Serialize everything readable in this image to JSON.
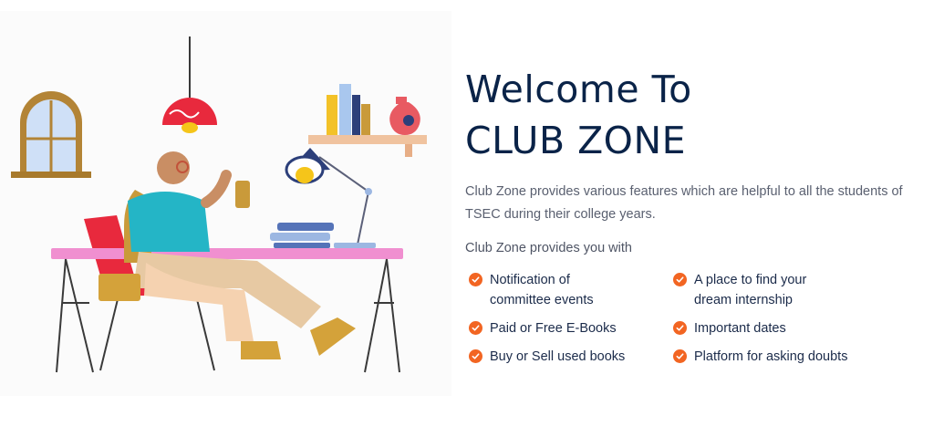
{
  "hero": {
    "title_line1": "Welcome To",
    "title_line2": "CLUB ZONE",
    "description": "Club Zone provides various features which are helpful to all the students of TSEC during their college years.",
    "subheading": "Club Zone provides you with"
  },
  "features": [
    {
      "label": "Notification of\ncommittee events",
      "icon": "check-circle-icon"
    },
    {
      "label": "A place to find your\ndream internship",
      "icon": "check-circle-icon"
    },
    {
      "label": "Paid or Free E-Books",
      "icon": "check-circle-icon"
    },
    {
      "label": "Important dates",
      "icon": "check-circle-icon"
    },
    {
      "label": "Buy or Sell used books",
      "icon": "check-circle-icon"
    },
    {
      "label": "Platform for asking doubts",
      "icon": "check-circle-icon"
    }
  ],
  "colors": {
    "accent": "#f26522",
    "title": "#0a2348",
    "body_text": "#5a6070"
  }
}
